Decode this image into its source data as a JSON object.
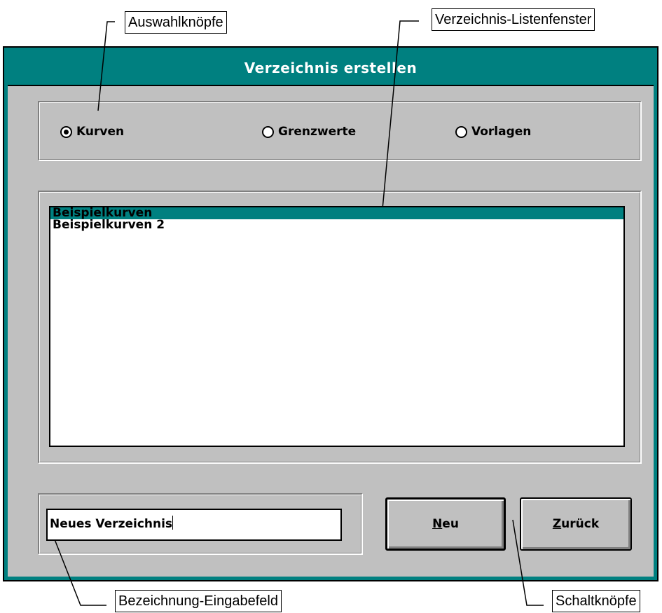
{
  "callouts": {
    "radio_buttons": "Auswahlknöpfe",
    "directory_list": "Verzeichnis-Listenfenster",
    "name_input": "Bezeichnung-Eingabefeld",
    "buttons": "Schaltknöpfe"
  },
  "dialog": {
    "title": "Verzeichnis erstellen",
    "radios": [
      {
        "label": "Kurven",
        "selected": true
      },
      {
        "label": "Grenzwerte",
        "selected": false
      },
      {
        "label": "Vorlagen",
        "selected": false
      }
    ],
    "list_items": [
      "Beispielkurven",
      "Beispielkurven 2"
    ],
    "selected_list_index": 0,
    "name_value": "Neues Verzeichnis",
    "buttons": {
      "new": {
        "mnemonic": "N",
        "rest": "eu"
      },
      "back": {
        "mnemonic": "Z",
        "rest": "urück"
      }
    }
  },
  "colors": {
    "titlebar": "#008080",
    "face": "#c0c0c0",
    "selection": "#008080"
  }
}
